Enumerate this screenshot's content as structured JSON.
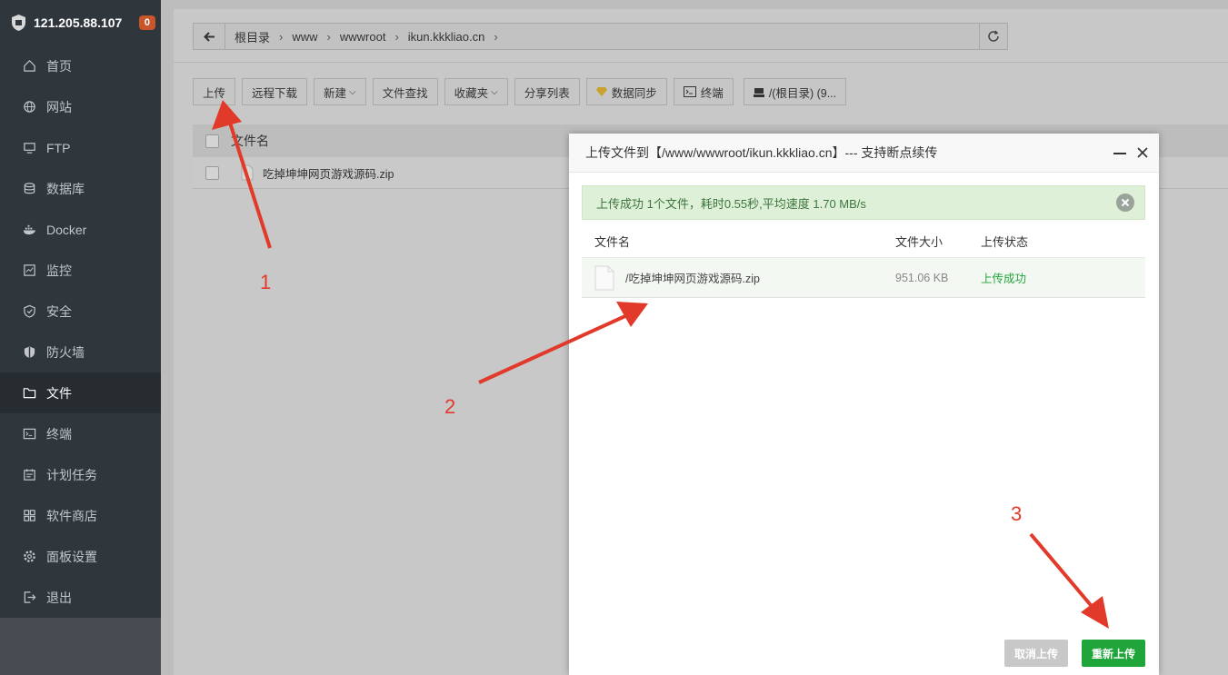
{
  "sidebar": {
    "server_ip": "121.205.88.107",
    "badge": "0",
    "items": [
      {
        "label": "首页",
        "icon": "home-icon"
      },
      {
        "label": "网站",
        "icon": "globe-icon"
      },
      {
        "label": "FTP",
        "icon": "ftp-icon"
      },
      {
        "label": "数据库",
        "icon": "database-icon"
      },
      {
        "label": "Docker",
        "icon": "docker-icon"
      },
      {
        "label": "监控",
        "icon": "monitor-icon"
      },
      {
        "label": "安全",
        "icon": "shield-icon"
      },
      {
        "label": "防火墙",
        "icon": "firewall-icon"
      },
      {
        "label": "文件",
        "icon": "folder-icon",
        "active": true
      },
      {
        "label": "终端",
        "icon": "terminal-icon"
      },
      {
        "label": "计划任务",
        "icon": "calendar-icon"
      },
      {
        "label": "软件商店",
        "icon": "apps-icon"
      },
      {
        "label": "面板设置",
        "icon": "gear-icon"
      },
      {
        "label": "退出",
        "icon": "logout-icon"
      }
    ]
  },
  "breadcrumb": [
    "根目录",
    "www",
    "wwwroot",
    "ikun.kkkliao.cn"
  ],
  "toolbar": {
    "upload": "上传",
    "remote_download": "远程下载",
    "new": "新建",
    "file_search": "文件查找",
    "favorites": "收藏夹",
    "share_list": "分享列表",
    "data_sync": "数据同步",
    "terminal": "终端",
    "disk": "/(根目录) (9..."
  },
  "file_table": {
    "col_name": "文件名",
    "rows": [
      {
        "name": "吃掉坤坤网页游戏源码.zip"
      }
    ]
  },
  "modal": {
    "title": "上传文件到【/www/wwwroot/ikun.kkkliao.cn】--- 支持断点续传",
    "alert": "上传成功 1个文件，耗时0.55秒,平均速度 1.70 MB/s",
    "col_name": "文件名",
    "col_size": "文件大小",
    "col_status": "上传状态",
    "rows": [
      {
        "name": "/吃掉坤坤网页游戏源码.zip",
        "size": "951.06 KB",
        "status": "上传成功"
      }
    ],
    "cancel_label": "取消上传",
    "retry_label": "重新上传"
  },
  "annotations": [
    "1",
    "2",
    "3"
  ],
  "colors": {
    "accent_green": "#20a53a",
    "arrow_red": "#e23a2a"
  }
}
